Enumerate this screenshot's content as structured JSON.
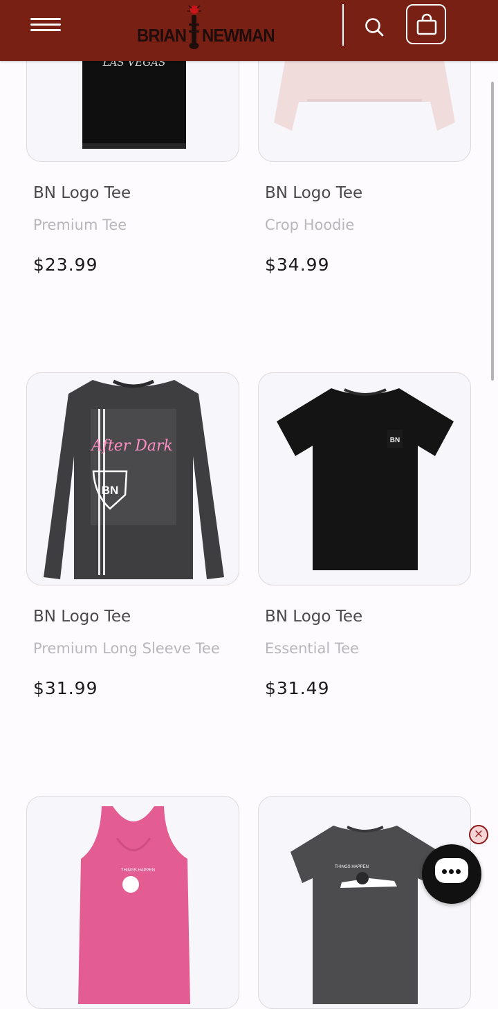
{
  "header": {
    "logo_left": "BRIAN",
    "logo_right": "NEWMAN",
    "menu_icon": "hamburger-menu-icon",
    "search_icon": "search-icon",
    "cart_icon": "shopping-bag-icon"
  },
  "products": [
    {
      "title": "BN Logo Tee",
      "subtitle": "Premium Tee",
      "price": "$23.99",
      "print_text": "LAS VEGAS"
    },
    {
      "title": "BN Logo Tee",
      "subtitle": "Crop Hoodie",
      "price": "$34.99"
    },
    {
      "title": "BN Logo Tee",
      "subtitle": "Premium Long Sleeve Tee",
      "price": "$31.99",
      "print_text": "After Dark",
      "print_badge": "BN"
    },
    {
      "title": "BN Logo Tee",
      "subtitle": "Essential Tee",
      "price": "$31.49",
      "print_badge": "BN"
    },
    {
      "title": "",
      "subtitle": "",
      "price": "",
      "print_text": "THINGS HAPPEN"
    },
    {
      "title": "",
      "subtitle": "",
      "price": "",
      "print_text": "THINGS HAPPEN"
    }
  ],
  "chat": {
    "close_glyph": "×",
    "icon": "chat-bubble-icon"
  },
  "colors": {
    "header_bg": "#782014",
    "accent_pink": "#e35d93"
  }
}
